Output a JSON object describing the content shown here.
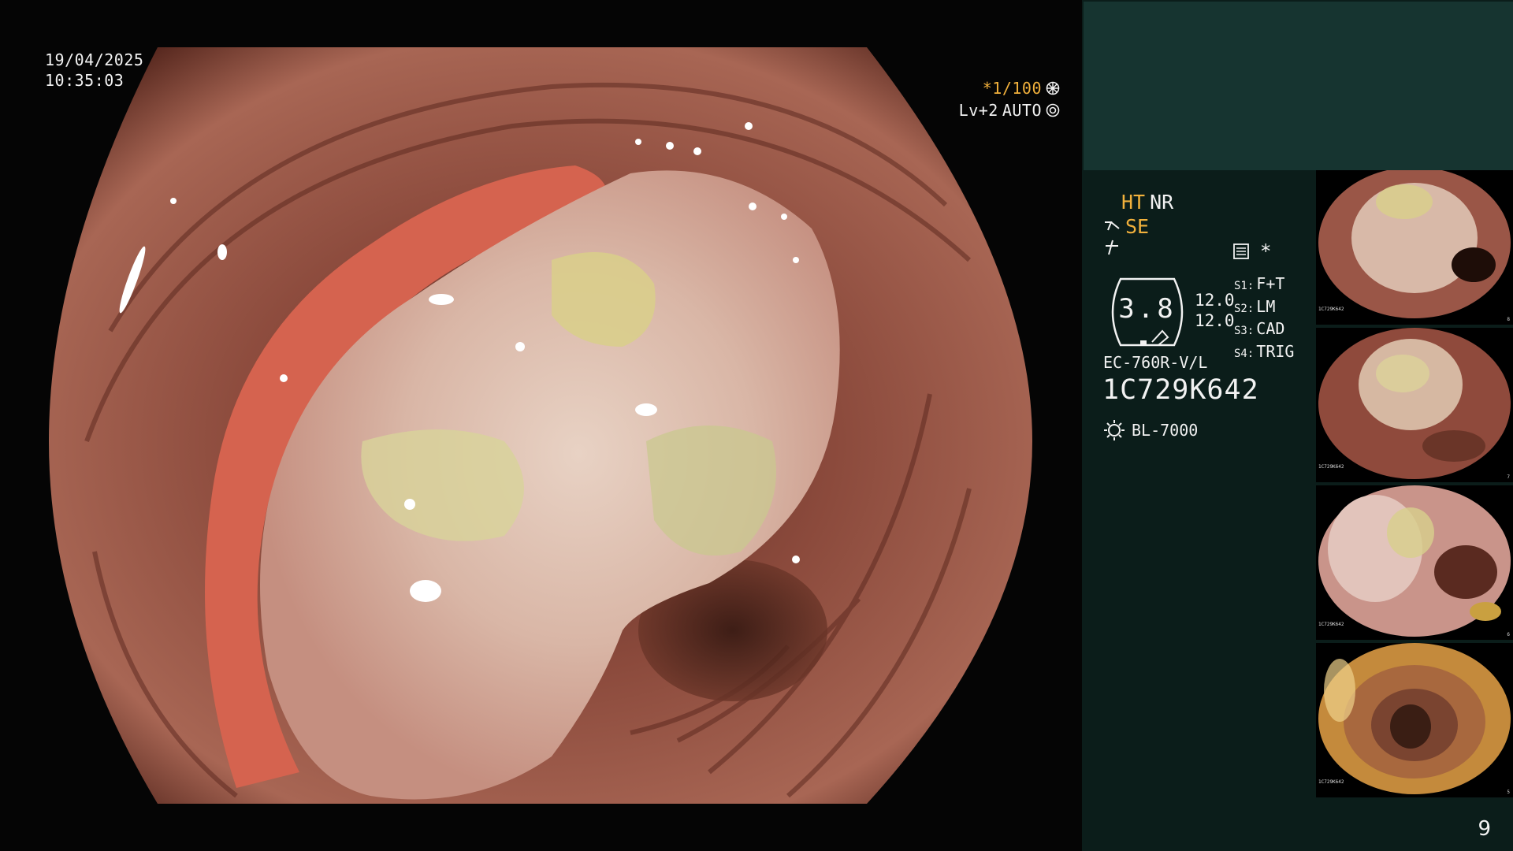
{
  "overlay": {
    "date": "19/04/2025",
    "time": "10:35:03",
    "shutter": "*1/100",
    "level": "Lv+2",
    "iris": "AUTO"
  },
  "panel": {
    "mode_ht": "HT",
    "mode_nr": "NR",
    "mode_se": "SE",
    "gauge_value": "3.8",
    "gauge_sub": [
      "12.0",
      "12.0"
    ],
    "switches": [
      {
        "key": "S1:",
        "value": "F+T"
      },
      {
        "key": "S2:",
        "value": "LM"
      },
      {
        "key": "S3:",
        "value": "CAD"
      },
      {
        "key": "S4:",
        "value": "TRIG"
      }
    ],
    "star": "*",
    "scope_model": "EC-760R-V/L",
    "scope_serial": "1C729K642",
    "light_source": "BL-7000",
    "icons": [
      "scope-se-icon",
      "freeze-icon",
      "menu-list-icon",
      "light-source-icon",
      "shutter-wheel-icon",
      "iris-auto-icon"
    ]
  },
  "thumbnails": [
    {
      "id_text": "1C729K642",
      "index": "8"
    },
    {
      "id_text": "1C729K642",
      "index": "7"
    },
    {
      "id_text": "1C729K642",
      "index": "6"
    },
    {
      "id_text": "1C729K642",
      "index": "5"
    }
  ],
  "colors": {
    "accent_orange": "#f2b13c",
    "panel_bg": "#0b1d1a",
    "teal_block": "#163430"
  },
  "page_number": "9"
}
